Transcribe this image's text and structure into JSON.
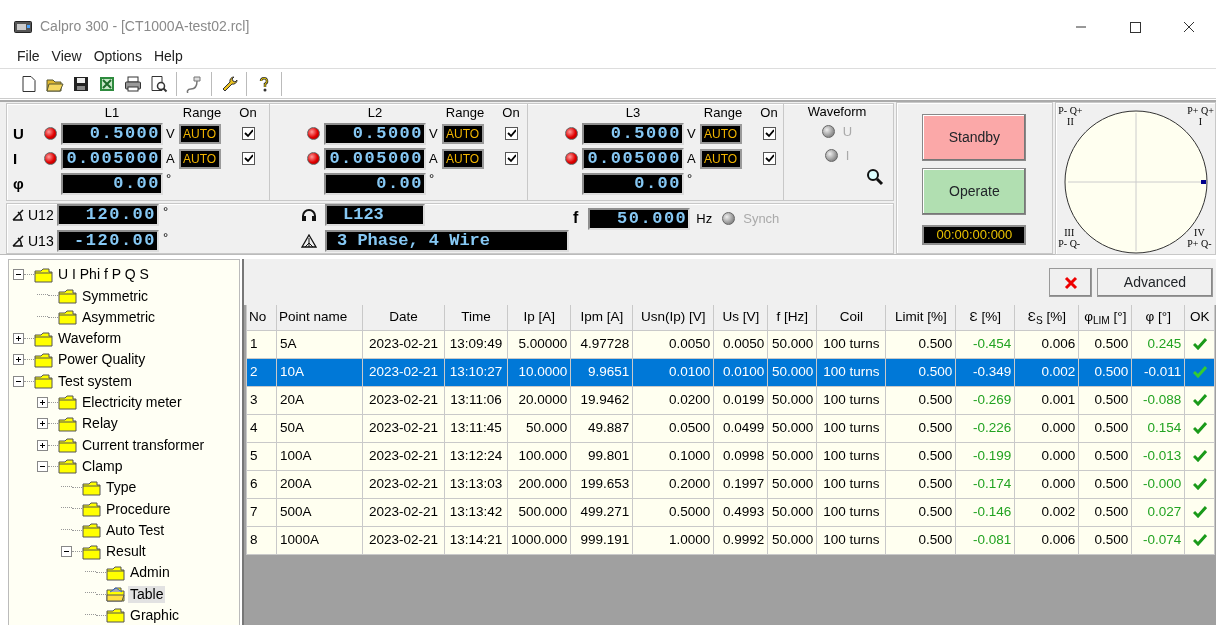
{
  "window": {
    "title": "Calpro 300 - [CT1000A-test02.rcl]"
  },
  "menu": [
    "File",
    "View",
    "Options",
    "Help"
  ],
  "measurement": {
    "row_labels": [
      "U",
      "I",
      "φ"
    ],
    "phases": [
      {
        "label": "L1",
        "range_heading": "Range",
        "on_heading": "On",
        "rows": [
          {
            "kind": "voltage",
            "indicator_on": true,
            "value": "0.5000",
            "unit": "V",
            "range": "AUTO",
            "on": true
          },
          {
            "kind": "current",
            "indicator_on": true,
            "value": "0.005000",
            "unit": "A",
            "range": "AUTO",
            "on": true
          },
          {
            "kind": "angle",
            "value": "0.00",
            "unit": "°"
          }
        ]
      },
      {
        "label": "L2",
        "range_heading": "Range",
        "on_heading": "On",
        "rows": [
          {
            "kind": "voltage",
            "indicator_on": true,
            "value": "0.5000",
            "unit": "V",
            "range": "AUTO",
            "on": true
          },
          {
            "kind": "current",
            "indicator_on": true,
            "value": "0.005000",
            "unit": "A",
            "range": "AUTO",
            "on": true
          },
          {
            "kind": "angle",
            "value": "0.00",
            "unit": "°"
          }
        ]
      },
      {
        "label": "L3",
        "range_heading": "Range",
        "on_heading": "On",
        "rows": [
          {
            "kind": "voltage",
            "indicator_on": true,
            "value": "0.5000",
            "unit": "V",
            "range": "AUTO",
            "on": true
          },
          {
            "kind": "current",
            "indicator_on": true,
            "value": "0.005000",
            "unit": "A",
            "range": "AUTO",
            "on": true
          },
          {
            "kind": "angle",
            "value": "0.00",
            "unit": "°"
          }
        ]
      }
    ],
    "waveform": {
      "title": "Waveform",
      "channels": [
        {
          "label": "U",
          "on": false
        },
        {
          "label": "I",
          "on": false
        }
      ]
    },
    "angles": [
      {
        "label": "U12",
        "value": "120.00",
        "unit": "°"
      },
      {
        "label": "U13",
        "value": "-120.00",
        "unit": "°"
      }
    ],
    "phase_sequence": "L123",
    "connection": "3 Phase, 4 Wire",
    "frequency": {
      "label": "f",
      "value": "50.000",
      "unit": "Hz",
      "synch_label": "Synch",
      "synch_on": false
    }
  },
  "output": {
    "buttons": [
      {
        "kind": "standby",
        "label": "Standby"
      },
      {
        "kind": "operate",
        "label": "Operate"
      }
    ],
    "timer": "00:00:00:000"
  },
  "phasor": {
    "quadrants": [
      {
        "numeral": "II",
        "sign": "P- Q+"
      },
      {
        "numeral": "I",
        "sign": "P+ Q+"
      },
      {
        "numeral": "III",
        "sign": "P- Q-"
      },
      {
        "numeral": "IV",
        "sign": "P+ Q-"
      }
    ]
  },
  "tree": [
    {
      "label": "U I Phi f P Q S",
      "expanded": true,
      "selected": false,
      "children": [
        {
          "label": "Symmetric",
          "selected": false
        },
        {
          "label": "Asymmetric",
          "selected": false
        }
      ]
    },
    {
      "label": "Waveform",
      "expanded": false,
      "selected": false
    },
    {
      "label": "Power Quality",
      "expanded": false,
      "selected": false
    },
    {
      "label": "Test system",
      "expanded": true,
      "selected": false,
      "children": [
        {
          "label": "Electricity meter",
          "expanded": false,
          "selected": false
        },
        {
          "label": "Relay",
          "expanded": false,
          "selected": false
        },
        {
          "label": "Current transformer",
          "expanded": false,
          "selected": false
        },
        {
          "label": "Clamp",
          "expanded": true,
          "selected": false,
          "children": [
            {
              "label": "Type",
              "selected": false
            },
            {
              "label": "Procedure",
              "selected": false
            },
            {
              "label": "Auto Test",
              "selected": false
            },
            {
              "label": "Result",
              "expanded": true,
              "selected": false,
              "children": [
                {
                  "label": "Admin",
                  "selected": false
                },
                {
                  "label": "Table",
                  "selected": true
                },
                {
                  "label": "Graphic",
                  "selected": false
                }
              ]
            }
          ]
        }
      ]
    }
  ],
  "result_toolbar": {
    "advanced_label": "Advanced"
  },
  "table": {
    "columns": [
      {
        "label": "No"
      },
      {
        "label": "Point name"
      },
      {
        "label": "Date"
      },
      {
        "label": "Time"
      },
      {
        "label": "Ip [A]"
      },
      {
        "label": "Ipm [A]"
      },
      {
        "label": "Usn(Ip) [V]"
      },
      {
        "label": "Us [V]"
      },
      {
        "label": "f [Hz]"
      },
      {
        "label": "Coil"
      },
      {
        "label": "Limit [%]"
      },
      {
        "label": "Ɛ [%]",
        "accent": true
      },
      {
        "label": "Ɛ$_{S}$ [%]"
      },
      {
        "label": "φ$_{LIM}$ [°]"
      },
      {
        "label": "φ [°]",
        "accent": true
      },
      {
        "label": "OK"
      }
    ],
    "rows": [
      {
        "selected": false,
        "ok": true,
        "cells": [
          "1",
          "5A",
          "2023-02-21",
          "13:09:49",
          "5.00000",
          "4.97728",
          "0.0050",
          "0.0050",
          "50.000",
          "100 turns",
          "0.500",
          "-0.454",
          "0.006",
          "0.500",
          "0.245"
        ]
      },
      {
        "selected": true,
        "ok": true,
        "cells": [
          "2",
          "10A",
          "2023-02-21",
          "13:10:27",
          "10.0000",
          "9.9651",
          "0.0100",
          "0.0100",
          "50.000",
          "100 turns",
          "0.500",
          "-0.349",
          "0.002",
          "0.500",
          "-0.011"
        ]
      },
      {
        "selected": false,
        "ok": true,
        "cells": [
          "3",
          "20A",
          "2023-02-21",
          "13:11:06",
          "20.0000",
          "19.9462",
          "0.0200",
          "0.0199",
          "50.000",
          "100 turns",
          "0.500",
          "-0.269",
          "0.001",
          "0.500",
          "-0.088"
        ]
      },
      {
        "selected": false,
        "ok": true,
        "cells": [
          "4",
          "50A",
          "2023-02-21",
          "13:11:45",
          "50.000",
          "49.887",
          "0.0500",
          "0.0499",
          "50.000",
          "100 turns",
          "0.500",
          "-0.226",
          "0.000",
          "0.500",
          "0.154"
        ]
      },
      {
        "selected": false,
        "ok": true,
        "cells": [
          "5",
          "100A",
          "2023-02-21",
          "13:12:24",
          "100.000",
          "99.801",
          "0.1000",
          "0.0998",
          "50.000",
          "100 turns",
          "0.500",
          "-0.199",
          "0.000",
          "0.500",
          "-0.013"
        ]
      },
      {
        "selected": false,
        "ok": true,
        "cells": [
          "6",
          "200A",
          "2023-02-21",
          "13:13:03",
          "200.000",
          "199.653",
          "0.2000",
          "0.1997",
          "50.000",
          "100 turns",
          "0.500",
          "-0.174",
          "0.000",
          "0.500",
          "-0.000"
        ]
      },
      {
        "selected": false,
        "ok": true,
        "cells": [
          "7",
          "500A",
          "2023-02-21",
          "13:13:42",
          "500.000",
          "499.271",
          "0.5000",
          "0.4993",
          "50.000",
          "100 turns",
          "0.500",
          "-0.146",
          "0.002",
          "0.500",
          "0.027"
        ]
      },
      {
        "selected": false,
        "ok": true,
        "cells": [
          "8",
          "1000A",
          "2023-02-21",
          "13:14:21",
          "1000.000",
          "999.191",
          "1.0000",
          "0.9992",
          "50.000",
          "100 turns",
          "0.500",
          "-0.081",
          "0.006",
          "0.500",
          "-0.074"
        ]
      }
    ]
  }
}
